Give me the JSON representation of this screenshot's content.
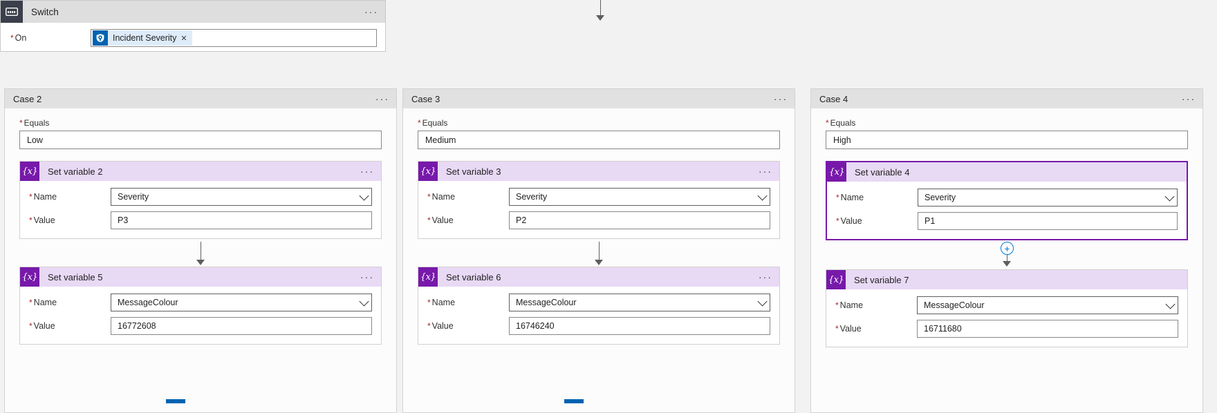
{
  "switch": {
    "title": "Switch",
    "icon": "switch-icon",
    "menu": "···",
    "on_label": "On",
    "required_marker": "*",
    "token": {
      "label": "Incident Severity",
      "icon": "sentinel-shield-icon",
      "remove": "✕"
    }
  },
  "cases": [
    {
      "title": "Case 2",
      "menu": "···",
      "equals_label": "Equals",
      "equals_value": "Low",
      "actions": [
        {
          "title": "Set variable 2",
          "icon": "{x}",
          "menu": "···",
          "selected": false,
          "name_label": "Name",
          "name_value": "Severity",
          "value_label": "Value",
          "value_value": "P3"
        },
        {
          "title": "Set variable 5",
          "icon": "{x}",
          "menu": "···",
          "selected": false,
          "name_label": "Name",
          "name_value": "MessageColour",
          "value_label": "Value",
          "value_value": "16772608"
        }
      ]
    },
    {
      "title": "Case 3",
      "menu": "···",
      "equals_label": "Equals",
      "equals_value": "Medium",
      "actions": [
        {
          "title": "Set variable 3",
          "icon": "{x}",
          "menu": "···",
          "selected": false,
          "name_label": "Name",
          "name_value": "Severity",
          "value_label": "Value",
          "value_value": "P2"
        },
        {
          "title": "Set variable 6",
          "icon": "{x}",
          "menu": "···",
          "selected": false,
          "name_label": "Name",
          "name_value": "MessageColour",
          "value_label": "Value",
          "value_value": "16746240"
        }
      ]
    },
    {
      "title": "Case 4",
      "menu": "···",
      "equals_label": "Equals",
      "equals_value": "High",
      "actions": [
        {
          "title": "Set variable 4",
          "icon": "{x}",
          "menu": "",
          "selected": true,
          "name_label": "Name",
          "name_value": "Severity",
          "value_label": "Value",
          "value_value": "P1"
        },
        {
          "title": "Set variable 7",
          "icon": "{x}",
          "menu": "",
          "selected": false,
          "name_label": "Name",
          "name_value": "MessageColour",
          "value_label": "Value",
          "value_value": "16711680"
        }
      ]
    }
  ],
  "add_step": {
    "glyph": "+"
  },
  "colors": {
    "accent_purple": "#7719AA",
    "header_lavender": "#E8D9F5",
    "case_header_grey": "#E1E1E2",
    "switch_icon_slate": "#3B3F4B",
    "token_blue": "#0063B1",
    "required_red": "#A4262C",
    "link_blue": "#0078D4"
  }
}
